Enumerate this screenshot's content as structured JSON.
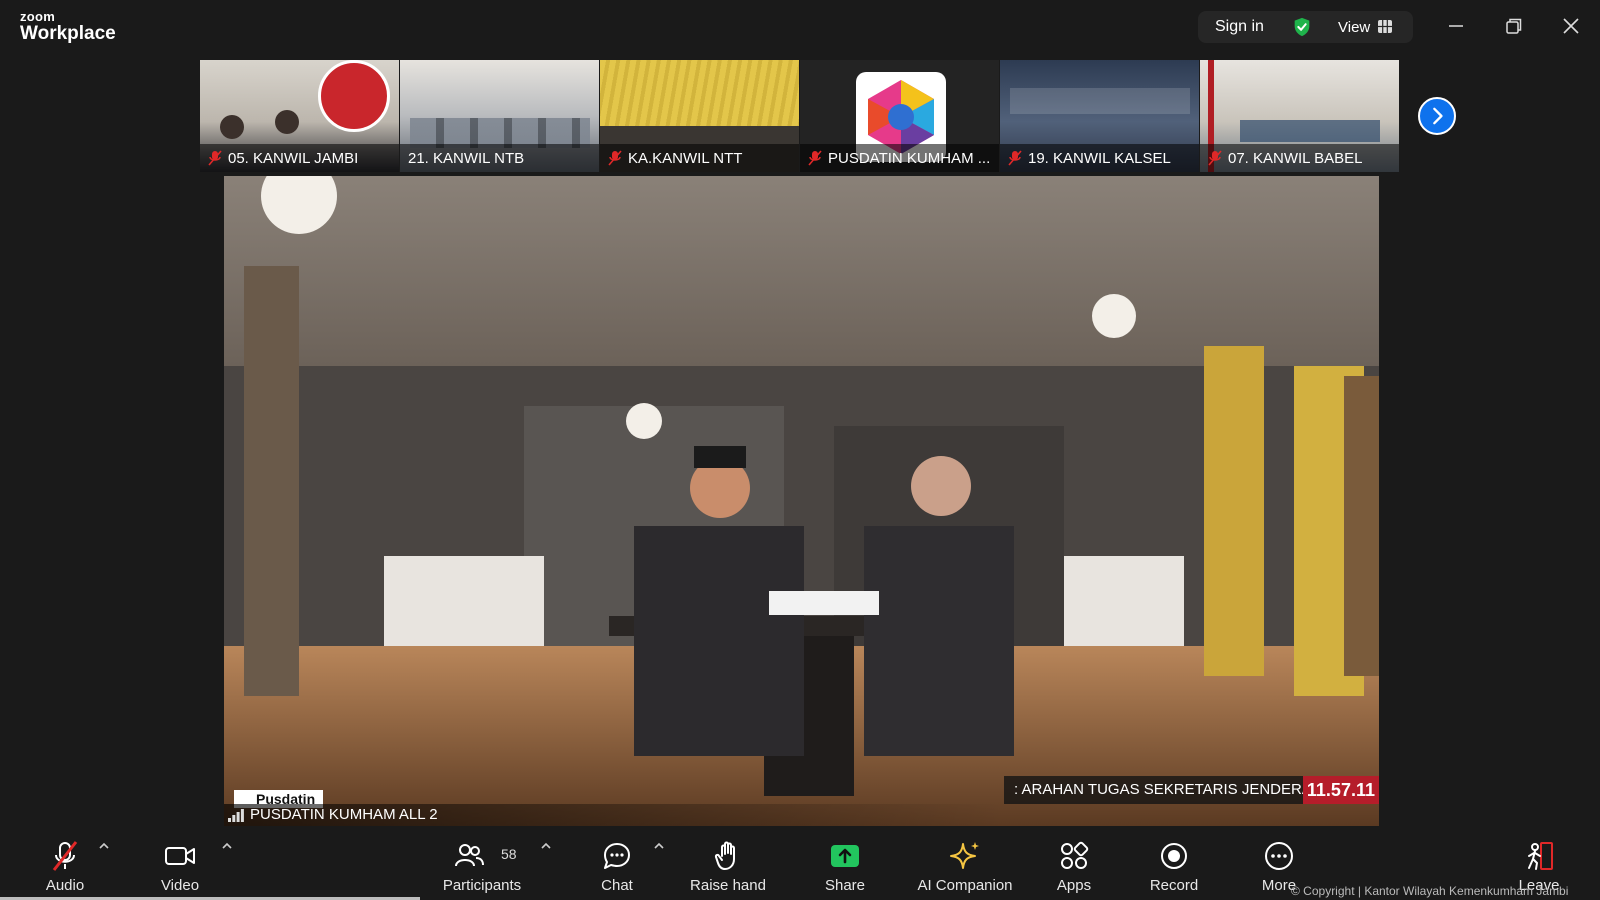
{
  "app": {
    "logo_top": "zoom",
    "logo_bottom": "Workplace"
  },
  "titlebar": {
    "signin_label": "Sign in",
    "view_label": "View",
    "shield_color": "#1fb34b"
  },
  "thumbnails": [
    {
      "name": "05. KANWIL JAMBI"
    },
    {
      "name": "21. KANWIL NTB"
    },
    {
      "name": "KA.KANWIL NTT"
    },
    {
      "name": "PUSDATIN KUMHAM ..."
    },
    {
      "name": "19. KANWIL KALSEL"
    },
    {
      "name": "07. KANWIL BABEL"
    }
  ],
  "main_video": {
    "logo_tag": "Pusdatin",
    "feed_name": "PUSDATIN KUMHAM ALL 2",
    "ticker_text": ": ARAHAN TUGAS SEKRETARIS JENDERAL",
    "ticker_time": "11.57.11"
  },
  "toolbar": {
    "audio": "Audio",
    "video": "Video",
    "participants": "Participants",
    "participants_count": "58",
    "chat": "Chat",
    "raise_hand": "Raise hand",
    "share": "Share",
    "ai_companion": "AI Companion",
    "apps": "Apps",
    "record": "Record",
    "more": "More",
    "leave": "Leave",
    "copyright": "© Copyright | Kantor Wilayah Kemenkumham Jambi"
  },
  "colors": {
    "accent": "#0e72ed",
    "share": "#22c55e",
    "mute": "#e02828",
    "ticker_time_bg": "#b51d2a"
  }
}
